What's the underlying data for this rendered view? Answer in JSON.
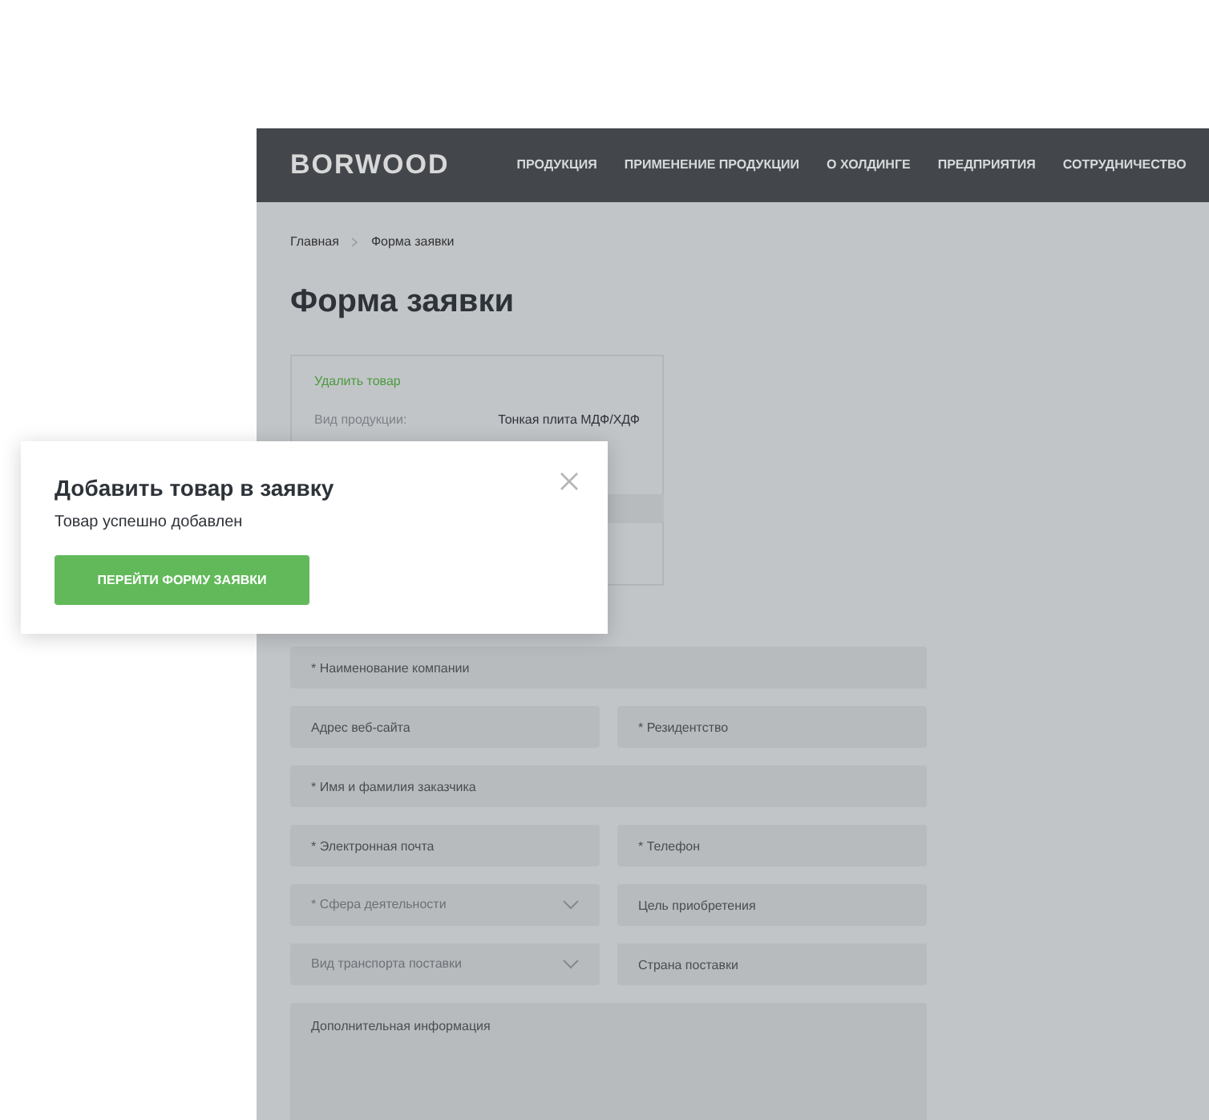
{
  "header": {
    "logo": "BORWOOD",
    "nav": [
      "ПРОДУКЦИЯ",
      "ПРИМЕНЕНИЕ ПРОДУКЦИИ",
      "О ХОЛДИНГЕ",
      "ПРЕДПРИЯТИЯ",
      "СОТРУДНИЧЕСТВО"
    ]
  },
  "breadcrumbs": [
    "Главная",
    "Форма заявки"
  ],
  "title": "Форма заявки",
  "product_card": {
    "remove_link": "Удалить товар",
    "label": "Вид продукции:",
    "value": "Тонкая плита МДФ/ХДФ"
  },
  "form_rows": [
    [
      {
        "kind": "text",
        "placeholder": "* Наименование компании"
      }
    ],
    [
      {
        "kind": "text",
        "placeholder": "Адрес веб-сайта"
      },
      {
        "kind": "text",
        "placeholder": "* Резидентство"
      }
    ],
    [
      {
        "kind": "text",
        "placeholder": "* Имя и фамилия заказчика"
      }
    ],
    [
      {
        "kind": "text",
        "placeholder": "* Электронная почта"
      },
      {
        "kind": "text",
        "placeholder": "* Телефон"
      }
    ],
    [
      {
        "kind": "select",
        "placeholder": "* Сфера деятельности"
      },
      {
        "kind": "text",
        "placeholder": "Цель приобретения"
      }
    ],
    [
      {
        "kind": "select",
        "placeholder": "Вид транспорта поставки"
      },
      {
        "kind": "text",
        "placeholder": "Страна поставки"
      }
    ],
    [
      {
        "kind": "textarea",
        "placeholder": "Дополнительная информация"
      }
    ]
  ],
  "dialog": {
    "title": "Добавить товар в заявку",
    "message": "Товар успешно добавлен",
    "button": "ПЕРЕЙТИ ФОРМУ ЗАЯВКИ"
  }
}
